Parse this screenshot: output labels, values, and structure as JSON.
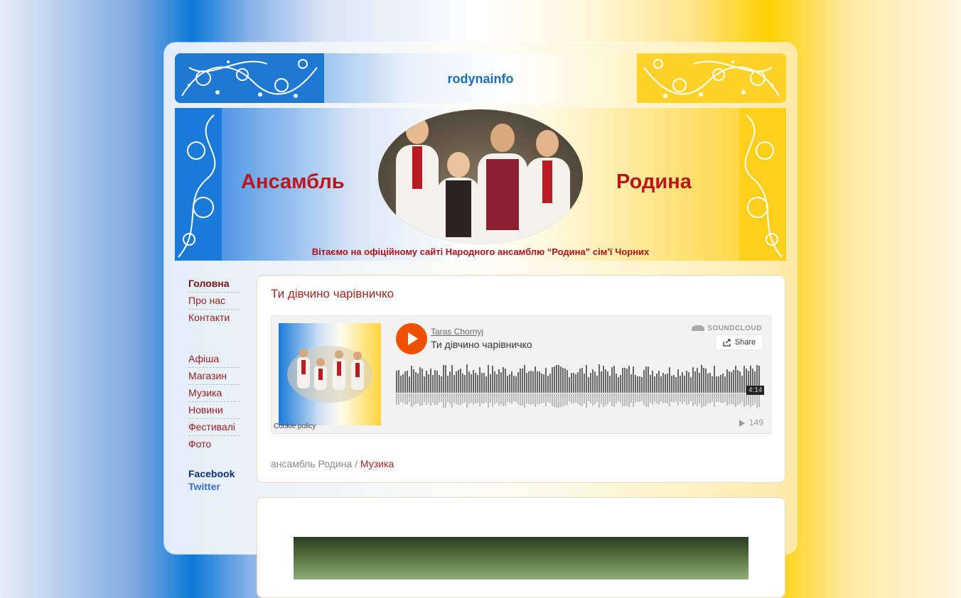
{
  "site": {
    "name": "rodynainfo",
    "hero_left": "Ансамбль",
    "hero_right": "Родина",
    "welcome": "Вітаємо на офіційному сайті Народного ансамблю “Родина” сім’ї Чорних"
  },
  "nav": {
    "primary": [
      {
        "label": "Головна",
        "active": true
      },
      {
        "label": "Про нас"
      },
      {
        "label": "Контакти"
      }
    ],
    "secondary": [
      {
        "label": "Афіша"
      },
      {
        "label": "Магазин"
      },
      {
        "label": "Музика"
      },
      {
        "label": "Новини"
      },
      {
        "label": "Фестивалі"
      },
      {
        "label": "Фото"
      }
    ]
  },
  "social": {
    "facebook": "Facebook",
    "twitter": "Twitter"
  },
  "post": {
    "title": "Ти дівчино чарівничко",
    "breadcrumb_root": "ансамбль Родина",
    "breadcrumb_sep": " / ",
    "breadcrumb_current": "Музика"
  },
  "player": {
    "artist": "Taras Chornyj",
    "track": "Ти дівчино чарівничко",
    "brand": "SOUNDCLOUD",
    "share_label": "Share",
    "duration": "4:14",
    "plays": "149",
    "cookie": "Cookie policy",
    "accent": "#f05000"
  },
  "colors": {
    "link": "#9a1b1b",
    "title": "#a3261d",
    "hero_word": "#c0141c",
    "brand_blue": "#1b6db7"
  }
}
